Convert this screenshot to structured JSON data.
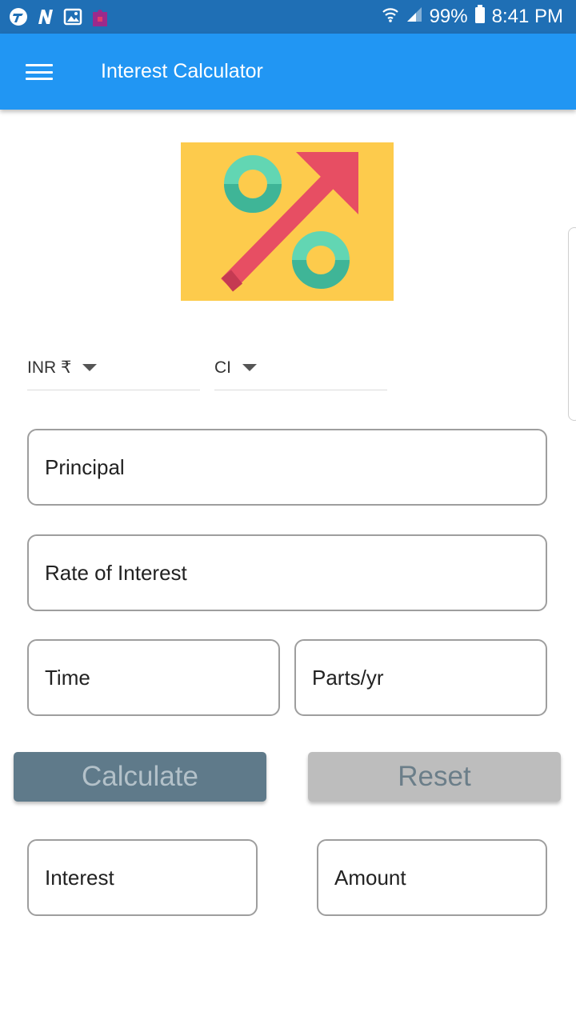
{
  "status_bar": {
    "battery": "99%",
    "time": "8:41 PM"
  },
  "app_bar": {
    "title": "Interest Calculator"
  },
  "dropdowns": {
    "currency": "INR ₹",
    "interest_type": "CI"
  },
  "fields": {
    "principal_placeholder": "Principal",
    "rate_placeholder": "Rate of Interest",
    "time_placeholder": "Time",
    "parts_placeholder": "Parts/yr",
    "interest_label": "Interest",
    "amount_label": "Amount"
  },
  "buttons": {
    "calculate": "Calculate",
    "reset": "Reset"
  },
  "colors": {
    "status_bar": "#1f6fb5",
    "app_bar": "#2196f3",
    "calculate_button": "#5f7a8a",
    "reset_button": "#bdbdbd",
    "logo_background": "#fdcb4c"
  }
}
